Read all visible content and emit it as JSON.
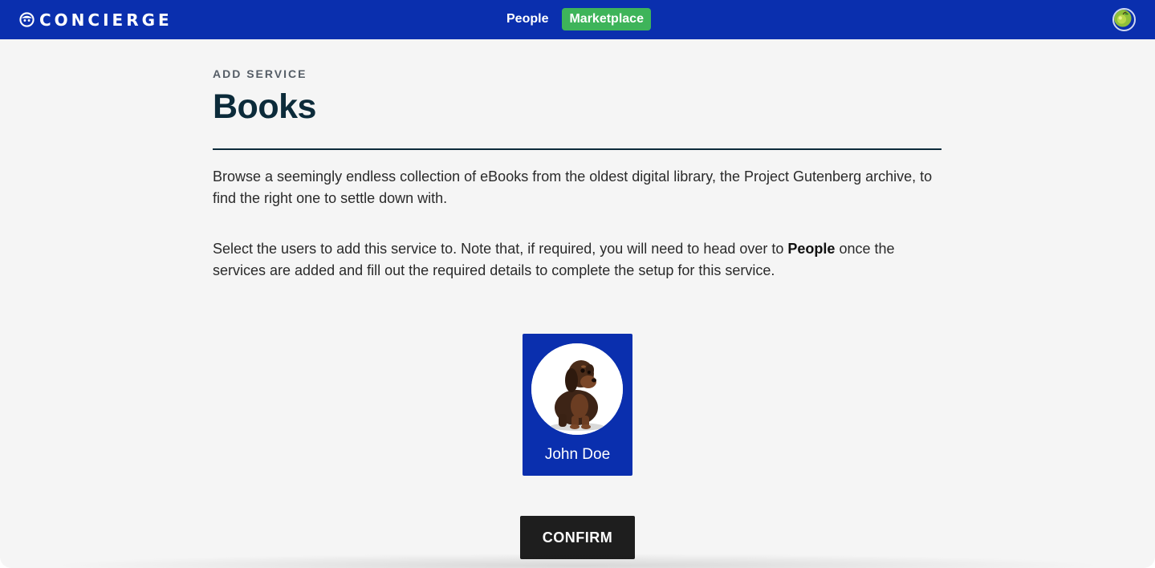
{
  "header": {
    "brand": "CONCIERGE",
    "brand_icon": "concierge-face-icon",
    "nav": [
      {
        "label": "People",
        "active": false
      },
      {
        "label": "Marketplace",
        "active": true
      }
    ],
    "avatar_icon": "apple-avatar-icon",
    "accent": "#0a2fae",
    "active_color": "#3eb45a"
  },
  "main": {
    "eyebrow": "ADD SERVICE",
    "title": "Books",
    "description": "Browse a seemingly endless collection of eBooks from the oldest digital library, the Project Gutenberg archive, to find the right one to settle down with.",
    "instructions": {
      "before": "Select the users to add this service to. Note that, if required, you will need to head over to ",
      "emphasis": "People",
      "after": " once the services are added and fill out the required details to complete the setup for this service."
    }
  },
  "users": [
    {
      "name": "John Doe",
      "photo_icon": "dachshund-puppy-photo",
      "selected": true
    }
  ],
  "actions": {
    "confirm_label": "CONFIRM"
  }
}
